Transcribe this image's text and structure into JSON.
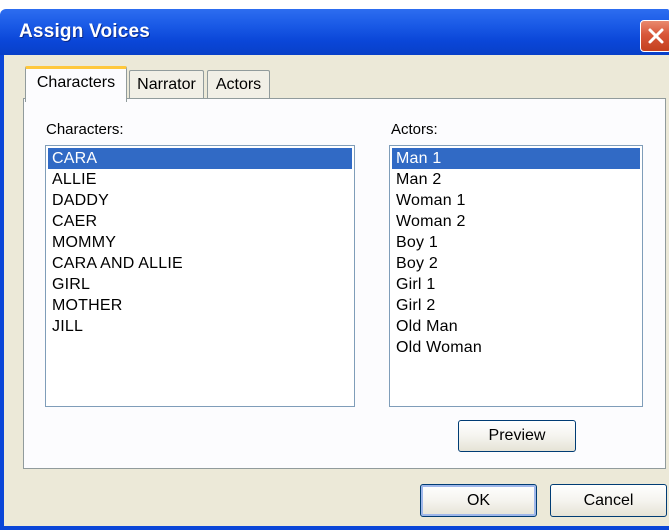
{
  "window": {
    "title": "Assign Voices"
  },
  "tabs": [
    {
      "label": "Characters"
    },
    {
      "label": "Narrator"
    },
    {
      "label": "Actors"
    }
  ],
  "characters": {
    "label": "Characters:",
    "items": [
      "CARA",
      "ALLIE",
      "DADDY",
      "CAER",
      "MOMMY",
      "CARA AND ALLIE",
      "GIRL",
      "MOTHER",
      "JILL"
    ],
    "selected": "CARA"
  },
  "actors": {
    "label": "Actors:",
    "items": [
      "Man 1",
      "Man 2",
      "Woman 1",
      "Woman 2",
      "Boy 1",
      "Boy 2",
      "Girl 1",
      "Girl 2",
      "Old Man",
      "Old Woman"
    ],
    "selected": "Man 1"
  },
  "buttons": {
    "preview": "Preview",
    "ok": "OK",
    "cancel": "Cancel"
  },
  "colors": {
    "titlebar": "#0a46d8",
    "selection": "#316ac5",
    "close": "#c4401f",
    "active_tab_accent": "#ffc83c"
  }
}
